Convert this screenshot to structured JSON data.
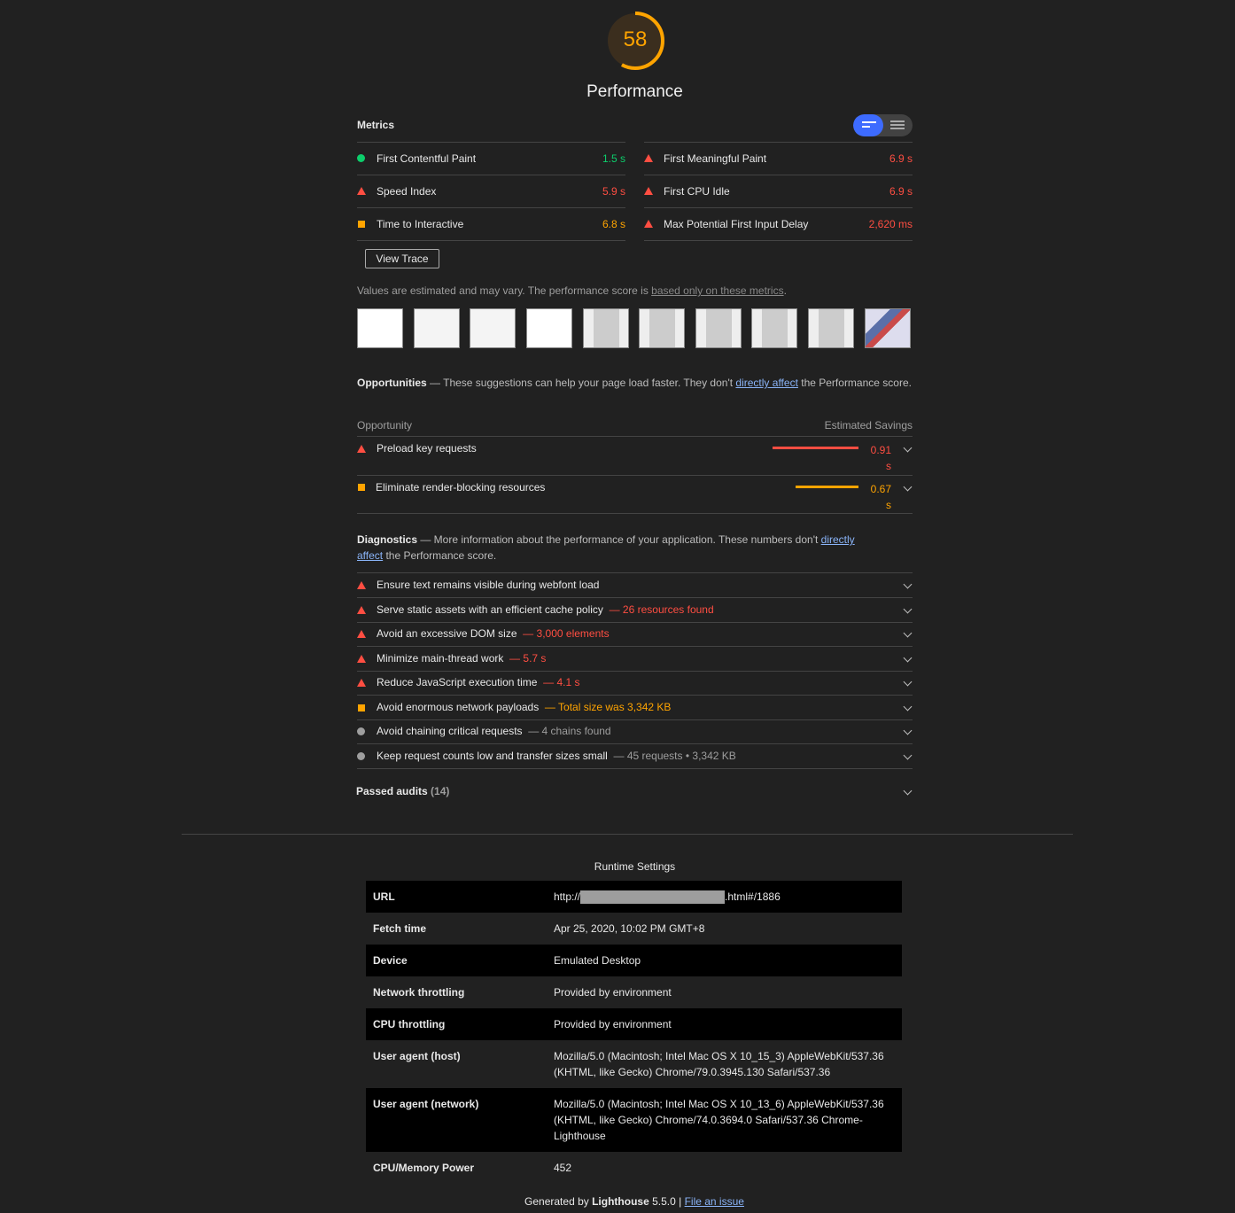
{
  "score": {
    "value": "58",
    "label": "Performance",
    "fraction": 0.58
  },
  "metrics": {
    "title": "Metrics",
    "left": [
      {
        "label": "First Contentful Paint",
        "value": "1.5 s",
        "status": "pass"
      },
      {
        "label": "Speed Index",
        "value": "5.9 s",
        "status": "fail"
      },
      {
        "label": "Time to Interactive",
        "value": "6.8 s",
        "status": "average"
      }
    ],
    "right": [
      {
        "label": "First Meaningful Paint",
        "value": "6.9 s",
        "status": "fail"
      },
      {
        "label": "First CPU Idle",
        "value": "6.9 s",
        "status": "fail"
      },
      {
        "label": "Max Potential First Input Delay",
        "value": "2,620 ms",
        "status": "fail"
      }
    ],
    "view_trace": "View Trace",
    "note_prefix": "Values are estimated and may vary. The performance score is ",
    "note_link": "based only on these metrics",
    "note_suffix": "."
  },
  "opportunities": {
    "title": "Opportunities",
    "desc_prefix": " — These suggestions can help your page load faster. They don't ",
    "desc_link": "directly affect",
    "desc_suffix": " the Performance score.",
    "col_left": "Opportunity",
    "col_right": "Estimated Savings",
    "items": [
      {
        "label": "Preload key requests",
        "value": "0.91",
        "unit": "s",
        "status": "fail"
      },
      {
        "label": "Eliminate render-blocking resources",
        "value": "0.67",
        "unit": "s",
        "status": "average"
      }
    ]
  },
  "diagnostics": {
    "title": "Diagnostics",
    "desc_prefix": " — More information about the performance of your application. These numbers don't ",
    "desc_link1": "directly",
    "desc_link2": "affect",
    "desc_suffix": " the Performance score.",
    "items": [
      {
        "label": "Ensure text remains visible during webfont load",
        "detail": "",
        "status": "fail"
      },
      {
        "label": "Serve static assets with an efficient cache policy",
        "detail": "26 resources found",
        "status": "fail"
      },
      {
        "label": "Avoid an excessive DOM size",
        "detail": "3,000 elements",
        "status": "fail"
      },
      {
        "label": "Minimize main-thread work",
        "detail": "5.7 s",
        "status": "fail"
      },
      {
        "label": "Reduce JavaScript execution time",
        "detail": "4.1 s",
        "status": "fail"
      },
      {
        "label": "Avoid enormous network payloads",
        "detail": "Total size was 3,342 KB",
        "status": "average"
      },
      {
        "label": "Avoid chaining critical requests",
        "detail": "4 chains found",
        "status": "info"
      },
      {
        "label": "Keep request counts low and transfer sizes small",
        "detail": "45 requests • 3,342 KB",
        "status": "info"
      }
    ]
  },
  "passed": {
    "label": "Passed audits",
    "count": "(14)"
  },
  "runtime": {
    "title": "Runtime Settings",
    "url_prefix": "http://",
    "url_suffix": ".html#/1886",
    "rows": [
      {
        "key": "Fetch time",
        "value": "Apr 25, 2020, 10:02 PM GMT+8"
      },
      {
        "key": "Device",
        "value": "Emulated Desktop"
      },
      {
        "key": "Network throttling",
        "value": "Provided by environment"
      },
      {
        "key": "CPU throttling",
        "value": "Provided by environment"
      },
      {
        "key": "User agent (host)",
        "value": "Mozilla/5.0 (Macintosh; Intel Mac OS X 10_15_3) AppleWebKit/537.36 (KHTML, like Gecko) Chrome/79.0.3945.130 Safari/537.36"
      },
      {
        "key": "User agent (network)",
        "value": "Mozilla/5.0 (Macintosh; Intel Mac OS X 10_13_6) AppleWebKit/537.36 (KHTML, like Gecko) Chrome/74.0.3694.0 Safari/537.36 Chrome-Lighthouse"
      },
      {
        "key": "CPU/Memory Power",
        "value": "452"
      }
    ],
    "url_key": "URL"
  },
  "footer": {
    "prefix": "Generated by ",
    "brand": "Lighthouse",
    "version": " 5.5.0 | ",
    "link": "File an issue"
  },
  "colors": {
    "fail": "#ff4e42",
    "average": "#ffa400",
    "pass": "#0cce6b",
    "info": "#9e9e9e",
    "accent": "#3d6bff"
  }
}
